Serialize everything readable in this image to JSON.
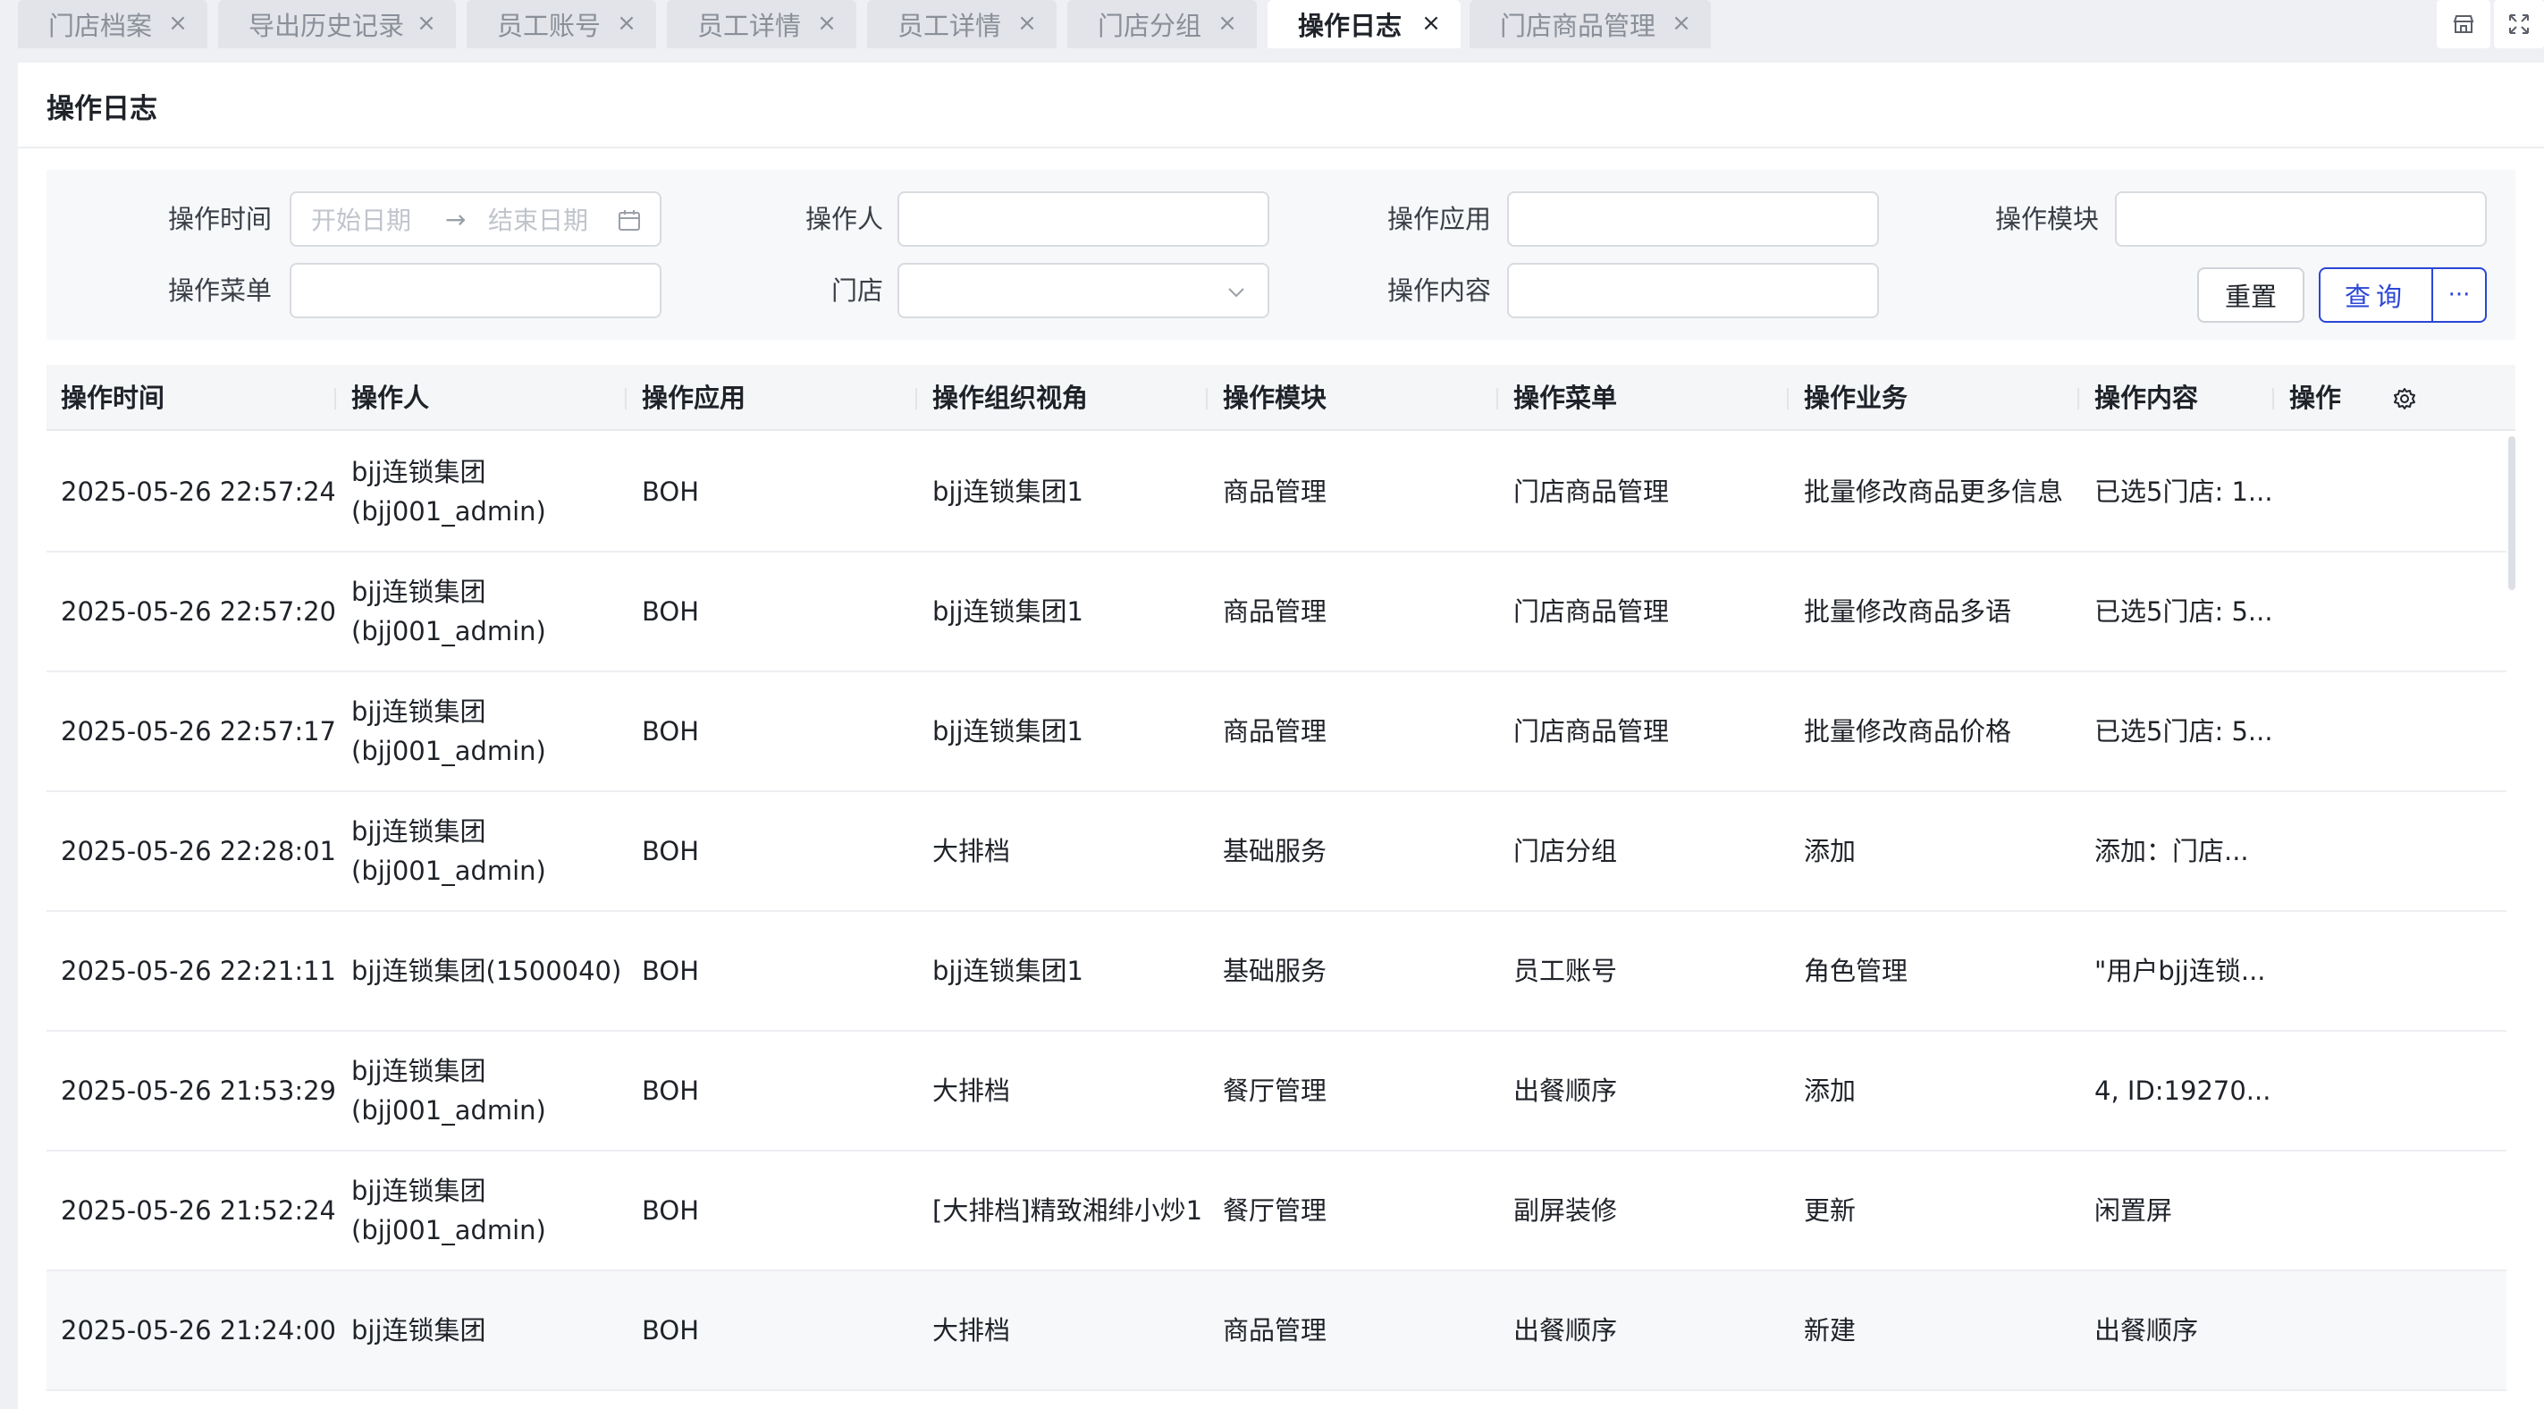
{
  "tabs": [
    {
      "label": "门店档案",
      "active": false
    },
    {
      "label": "导出历史记录",
      "active": false
    },
    {
      "label": "员工账号",
      "active": false
    },
    {
      "label": "员工详情",
      "active": false
    },
    {
      "label": "员工详情",
      "active": false
    },
    {
      "label": "门店分组",
      "active": false
    },
    {
      "label": "操作日志",
      "active": true
    },
    {
      "label": "门店商品管理",
      "active": false
    }
  ],
  "tab_close_glyph": "×",
  "toolbar": {
    "store_icon": "store-icon",
    "fullscreen_icon": "fullscreen-icon"
  },
  "page": {
    "title": "操作日志"
  },
  "filters": {
    "op_time_label": "操作时间",
    "start_date_placeholder": "开始日期",
    "date_arrow": "→",
    "end_date_placeholder": "结束日期",
    "operator_label": "操作人",
    "app_label": "操作应用",
    "module_label": "操作模块",
    "menu_label": "操作菜单",
    "store_label": "门店",
    "content_label": "操作内容",
    "reset_label": "重置",
    "query_label": "查询",
    "more_label": "···"
  },
  "table": {
    "columns": [
      "操作时间",
      "操作人",
      "操作应用",
      "操作组织视角",
      "操作模块",
      "操作菜单",
      "操作业务",
      "操作内容",
      "操作"
    ],
    "rows": [
      {
        "time": "2025-05-26 22:57:24",
        "operator_line1": "bjj连锁集团",
        "operator_line2": "(bjj001_admin)",
        "app": "BOH",
        "org": "bjj连锁集团1",
        "module": "商品管理",
        "menu": "门店商品管理",
        "business": "批量修改商品更多信息",
        "content": "已选5门店: 1..."
      },
      {
        "time": "2025-05-26 22:57:20",
        "operator_line1": "bjj连锁集团",
        "operator_line2": "(bjj001_admin)",
        "app": "BOH",
        "org": "bjj连锁集团1",
        "module": "商品管理",
        "menu": "门店商品管理",
        "business": "批量修改商品多语",
        "content": "已选5门店: 5..."
      },
      {
        "time": "2025-05-26 22:57:17",
        "operator_line1": "bjj连锁集团",
        "operator_line2": "(bjj001_admin)",
        "app": "BOH",
        "org": "bjj连锁集团1",
        "module": "商品管理",
        "menu": "门店商品管理",
        "business": "批量修改商品价格",
        "content": "已选5门店: 5..."
      },
      {
        "time": "2025-05-26 22:28:01",
        "operator_line1": "bjj连锁集团",
        "operator_line2": "(bjj001_admin)",
        "app": "BOH",
        "org": "大排档",
        "module": "基础服务",
        "menu": "门店分组",
        "business": "添加",
        "content": "添加：门店..."
      },
      {
        "time": "2025-05-26 22:21:11",
        "operator_line1": "bjj连锁集团(1500040)",
        "operator_line2": "",
        "app": "BOH",
        "org": "bjj连锁集团1",
        "module": "基础服务",
        "menu": "员工账号",
        "business": "角色管理",
        "content": "\"用户bjj连锁..."
      },
      {
        "time": "2025-05-26 21:53:29",
        "operator_line1": "bjj连锁集团",
        "operator_line2": "(bjj001_admin)",
        "app": "BOH",
        "org": "大排档",
        "module": "餐厅管理",
        "menu": "出餐顺序",
        "business": "添加",
        "content": "4, ID:19270..."
      },
      {
        "time": "2025-05-26 21:52:24",
        "operator_line1": "bjj连锁集团",
        "operator_line2": "(bjj001_admin)",
        "app": "BOH",
        "org": "[大排档]精致湘绯小炒1",
        "module": "餐厅管理",
        "menu": "副屏装修",
        "business": "更新",
        "content": "闲置屏"
      },
      {
        "time": "2025-05-26 21:24:00",
        "operator_line1": "bjj连锁集团",
        "operator_line2": "",
        "app": "BOH",
        "org": "大排档",
        "module": "商品管理",
        "menu": "出餐顺序",
        "business": "新建",
        "content": "出餐顺序"
      }
    ]
  },
  "colors": {
    "primary": "#2b46d6",
    "page_bg": "#eef0f4",
    "header_bg": "#f5f6f8"
  }
}
